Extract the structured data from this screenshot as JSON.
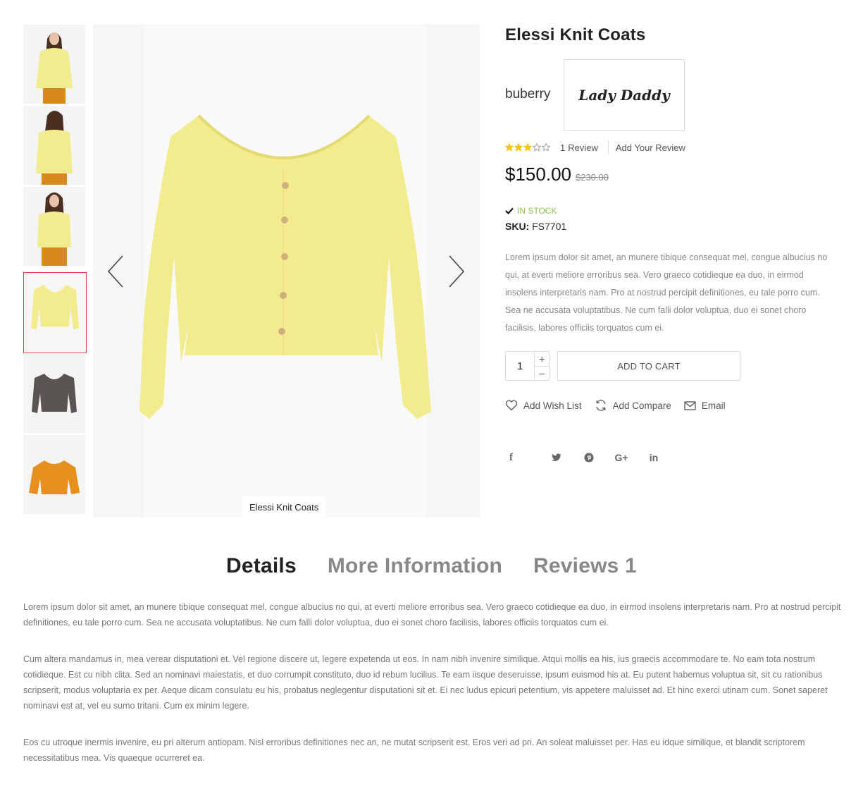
{
  "product": {
    "title": "Elessi Knit Coats",
    "brand": "buberry",
    "brand_logo_text": "Lady Daddy",
    "rating": 3,
    "rating_max": 5,
    "review_count": "1",
    "review_label": "Review",
    "add_review_label": "Add Your Review",
    "price": "$150.00",
    "old_price": "$230.00",
    "stock": "IN STOCK",
    "sku_label": "SKU:",
    "sku": "FS7701",
    "description": "Lorem ipsum dolor sit amet, an munere tibique consequat mel, congue albucius no qui, at everti meliore erroribus sea. Vero graeco cotidieque ea duo, in eirmod insolens interpretaris nam. Pro at nostrud percipit definitiones, eu tale porro cum. Sea ne accusata voluptatibus. Ne cum falli dolor voluptua, duo ei sonet choro facilisis, labores officiis torquatos cum ei.",
    "quantity": "1",
    "add_to_cart": "ADD TO CART",
    "image_caption": "Elessi Knit Coats",
    "colors": {
      "yellow": "#f2ec8f",
      "dark": "#5a5552",
      "orange": "#e8901e",
      "active_border": "#e0474c",
      "stock_green": "#8bc34a",
      "star": "#f5c518"
    }
  },
  "gallery": {
    "thumbnails": [
      {
        "name": "thumb-model-front",
        "color": "#f2ec8f"
      },
      {
        "name": "thumb-model-back",
        "color": "#f2ec8f"
      },
      {
        "name": "thumb-model-side",
        "color": "#f2ec8f"
      },
      {
        "name": "thumb-yellow-sweater",
        "color": "#f2ec8f",
        "active": true
      },
      {
        "name": "thumb-dark-sweater",
        "color": "#5a5552"
      },
      {
        "name": "thumb-orange-sweater",
        "color": "#e8901e"
      }
    ]
  },
  "actions": {
    "wishlist": "Add Wish List",
    "compare": "Add Compare",
    "email": "Email"
  },
  "socials": [
    "facebook-icon",
    "twitter-icon",
    "pinterest-icon",
    "google-plus-icon",
    "linkedin-icon"
  ],
  "tabs": {
    "details": "Details",
    "more_info": "More Information",
    "reviews": "Reviews 1"
  },
  "details": {
    "p1": "Lorem ipsum dolor sit amet, an munere tibique consequat mel, congue albucius no qui, at everti meliore erroribus sea. Vero graeco cotidieque ea duo, in eirmod insolens interpretaris nam. Pro at nostrud percipit definitiones, eu tale porro cum. Sea ne accusata voluptatibus. Ne cum falli dolor voluptua, duo ei sonet choro facilisis, labores officiis torquatos cum ei.",
    "p2": "Cum altera mandamus in, mea verear disputationi et. Vel regione discere ut, legere expetenda ut eos. In nam nibh invenire similique. Atqui mollis ea his, ius graecis accommodare te. No eam tota nostrum cotidieque. Est cu nibh clita. Sed an nominavi maiestatis, et duo corrumpit constituto, duo id rebum lucilius. Te eam iisque deseruisse, ipsum euismod his at. Eu putent habemus voluptua sit, sit cu rationibus scripserit, modus voluptaria ex per. Aeque dicam consulatu eu his, probatus neglegentur disputationi sit et. Ei nec ludus epicuri petentium, vis appetere maluisset ad. Et hinc exerci utinam cum. Sonet saperet nominavi est at, vel eu sumo tritani. Cum ex minim legere.",
    "p3": "Eos cu utroque inermis invenire, eu pri alterum antiopam. Nisl erroribus definitiones nec an, ne mutat scripserit est. Eros veri ad pri. An soleat maluisset per. Has eu idque similique, et blandit scriptorem necessitatibus mea. Vis quaeque ocurreret ea."
  }
}
